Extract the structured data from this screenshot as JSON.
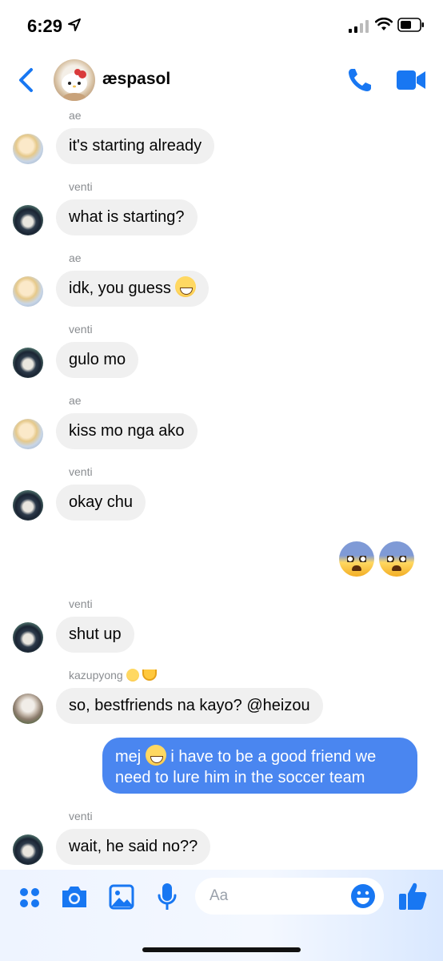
{
  "status_bar": {
    "time": "6:29"
  },
  "header": {
    "title": "æspasol"
  },
  "messages": [
    {
      "sender": "ae",
      "text": "it's starting already"
    },
    {
      "sender": "venti",
      "text": "what is starting?"
    },
    {
      "sender": "ae",
      "text": "idk, you guess"
    },
    {
      "sender": "venti",
      "text": "gulo mo"
    },
    {
      "sender": "ae",
      "text": "kiss mo nga ako"
    },
    {
      "sender": "venti",
      "text": "okay chu"
    },
    {
      "sender": "venti",
      "text": "shut up"
    },
    {
      "sender": "kazupyong",
      "text": "so, bestfriends na kayo? @heizou"
    },
    {
      "sender": "venti",
      "text": "wait, he said no??"
    }
  ],
  "my_message": {
    "line1_pre": "mej",
    "line1_post": "i have to be a good friend we",
    "line2": "need to lure him in the soccer team"
  },
  "composer": {
    "placeholder": "Aa"
  },
  "colors": {
    "accent": "#1877f2",
    "my_bubble": "#4a86f0",
    "their_bubble": "#f0f0f0"
  }
}
